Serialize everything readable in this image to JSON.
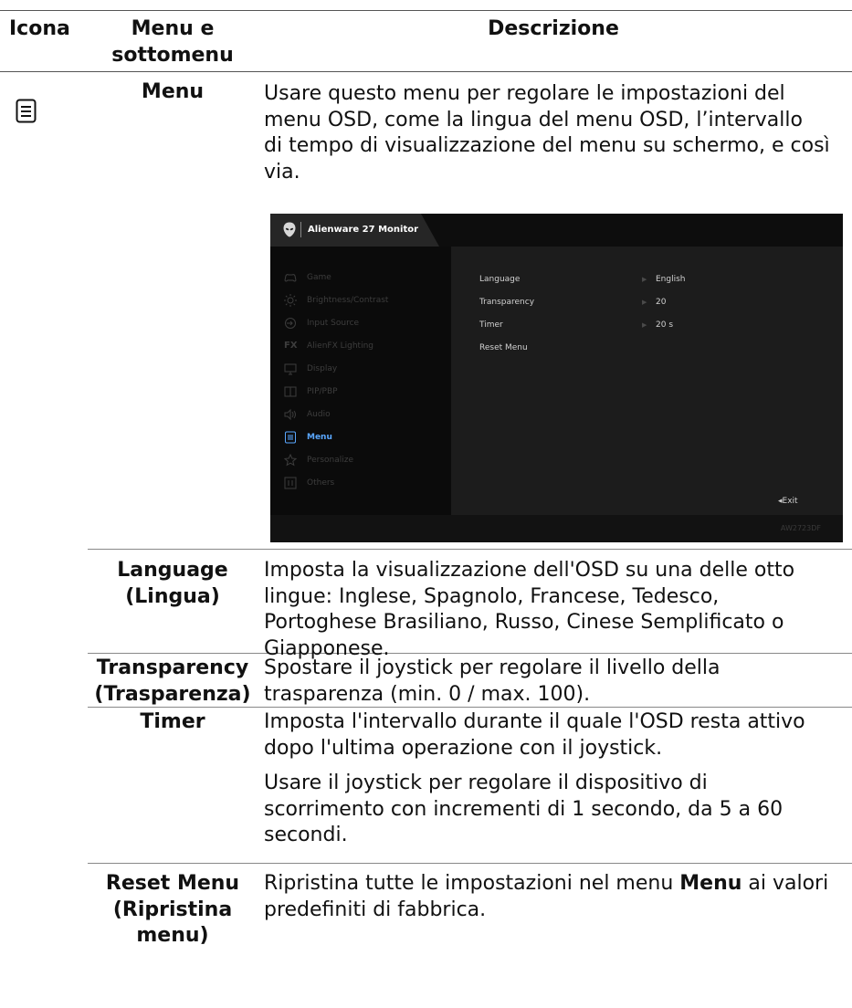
{
  "header": {
    "col_icon": "Icona",
    "col_menu_line1": "Menu e",
    "col_menu_line2": "sottomenu",
    "col_desc": "Descrizione"
  },
  "rows": {
    "menu": {
      "label": "Menu",
      "icon": "menu-list-icon",
      "desc_lines": [
        "Usare questo menu per regolare le impostazioni del",
        "menu OSD, come la lingua del menu OSD, l’intervallo",
        "di tempo di visualizzazione del menu su schermo, e così",
        "via."
      ]
    },
    "language": {
      "label_line1": "Language",
      "label_line2": "(Lingua)",
      "desc_lines": [
        "Imposta la visualizzazione dell'OSD su una delle otto",
        "lingue: Inglese, Spagnolo, Francese, Tedesco,",
        "Portoghese Brasiliano, Russo, Cinese Semplificato o",
        "Giapponese."
      ]
    },
    "transparency": {
      "label_line1": "Transparency",
      "label_line2": "(Trasparenza)",
      "desc_lines": [
        "Spostare il joystick per regolare il livello della",
        "trasparenza (min. 0 / max. 100)."
      ]
    },
    "timer": {
      "label": "Timer",
      "desc1_lines": [
        "Imposta l'intervallo durante il quale l'OSD resta attivo",
        "dopo l'ultima operazione con il joystick."
      ],
      "desc2_lines": [
        "Usare il joystick per regolare il dispositivo di",
        "scorrimento con incrementi di 1 secondo, da 5 a 60",
        "secondi."
      ]
    },
    "reset": {
      "label_line1": "Reset Menu",
      "label_line2": "(Ripristina",
      "label_line3": "menu)",
      "desc_pre": "Ripristina tutte le impostazioni nel menu ",
      "desc_bold": "Menu",
      "desc_post": " ai valori",
      "desc_line2": "predefiniti di fabbrica."
    }
  },
  "osd": {
    "title": "Alienware 27 Monitor",
    "menu_items": [
      {
        "label": "Game",
        "icon": "gamepad-icon",
        "active": false
      },
      {
        "label": "Brightness/Contrast",
        "icon": "brightness-icon",
        "active": false
      },
      {
        "label": "Input Source",
        "icon": "input-source-icon",
        "active": false
      },
      {
        "label": "AlienFX Lighting",
        "icon": "fx-icon",
        "active": false
      },
      {
        "label": "Display",
        "icon": "display-icon",
        "active": false
      },
      {
        "label": "PIP/PBP",
        "icon": "pip-icon",
        "active": false
      },
      {
        "label": "Audio",
        "icon": "speaker-icon",
        "active": false
      },
      {
        "label": "Menu",
        "icon": "menu-list-icon",
        "active": true
      },
      {
        "label": "Personalize",
        "icon": "star-icon",
        "active": false
      },
      {
        "label": "Others",
        "icon": "others-icon",
        "active": false
      }
    ],
    "options": [
      {
        "label": "Language",
        "value": "English"
      },
      {
        "label": "Transparency",
        "value": "20"
      },
      {
        "label": "Timer",
        "value": "20 s"
      },
      {
        "label": "Reset Menu",
        "value": ""
      }
    ],
    "exit_label": "◂Exit",
    "model": "AW2723DF"
  }
}
